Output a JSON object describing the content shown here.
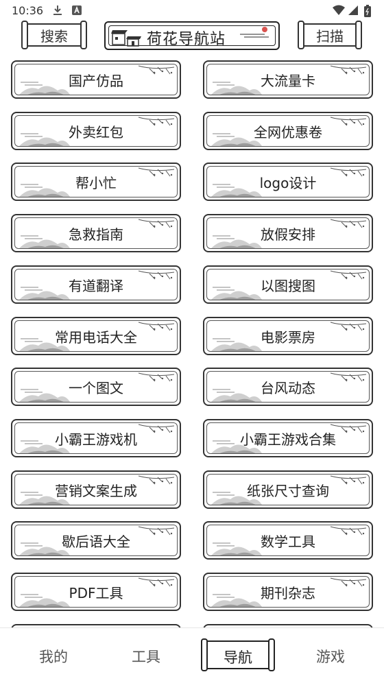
{
  "status": {
    "time": "10:36",
    "icons": [
      "download-icon",
      "notification-a-icon",
      "wifi-icon",
      "signal-icon",
      "battery-icon"
    ]
  },
  "header": {
    "search_label": "搜索",
    "title": "荷花导航站",
    "scan_label": "扫描"
  },
  "grid": {
    "items": [
      "国产仿品",
      "大流量卡",
      "外卖红包",
      "全网优惠卷",
      "帮小忙",
      "logo设计",
      "急救指南",
      "放假安排",
      "有道翻译",
      "以图搜图",
      "常用电话大全",
      "电影票房",
      "一个图文",
      "台风动态",
      "小霸王游戏机",
      "小霸王游戏合集",
      "营销文案生成",
      "纸张尺寸查询",
      "歇后语大全",
      "数学工具",
      "PDF工具",
      "期刊杂志",
      "",
      ""
    ]
  },
  "bottom_nav": {
    "items": [
      {
        "label": "我的"
      },
      {
        "label": "工具"
      },
      {
        "label": "导航"
      },
      {
        "label": "游戏"
      }
    ],
    "active_index": 2
  },
  "colors": {
    "ink": "#222222",
    "background": "#ffffff"
  }
}
